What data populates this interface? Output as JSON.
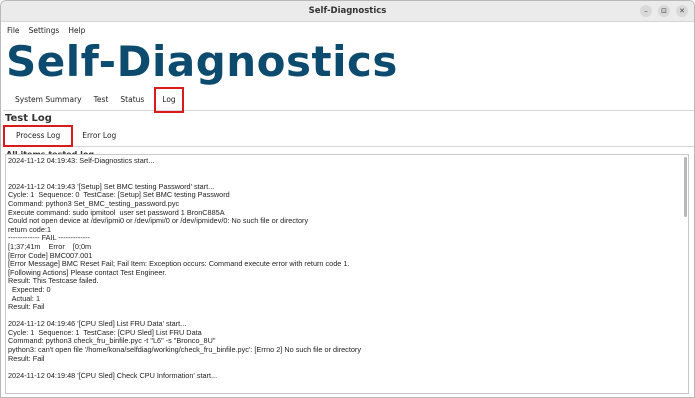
{
  "window": {
    "title": "Self-Diagnostics",
    "controls": [
      "–",
      "⊡",
      "✕"
    ]
  },
  "menu": [
    "File",
    "Settings",
    "Help"
  ],
  "app_title": "Self-Diagnostics",
  "tabs": [
    "System Summary",
    "Test",
    "Status",
    "Log"
  ],
  "section_title": "Test Log",
  "subtabs": [
    "Process Log",
    "Error Log"
  ],
  "log_header": "All items tested log",
  "log_lines": [
    "2024-11-12 04:19:43: Self-Diagnostics start...",
    "",
    "",
    "2024-11-12 04:19:43 '[Setup] Set BMC testing Password' start...",
    "Cycle: 1  Sequence: 0  TestCase: [Setup] Set BMC testing Password",
    "Command: python3 Set_BMC_testing_password.pyc",
    "Execute command: sudo ipmitool  user set password 1 BronC885A",
    "Could not open device at /dev/ipmi0 or /dev/ipmi/0 or /dev/ipmidev/0: No such file or directory",
    "return code:1",
    "------------- FAIL -------------",
    "[1;37;41m    Error    [0;0m",
    "[Error Code] BMC007.001",
    "[Error Message] BMC Reset Fail; Fail Item: Exception occurs: Command execute error with return code 1.",
    "[Following Actions] Please contact Test Engineer.",
    "Result: This Testcase failed.",
    "  Expected: 0",
    "  Actual: 1",
    "Result: Fail",
    "",
    "2024-11-12 04:19:46 '[CPU Sled] List FRU Data' start...",
    "Cycle: 1  Sequence: 1  TestCase: [CPU Sled] List FRU Data",
    "Command: python3 check_fru_binfile.pyc -t \"L6\" -s \"Bronco_8U\"",
    "python3: can't open file '/home/kona/selfdiag/working/check_fru_binfile.pyc': [Errno 2] No such file or directory",
    "Result: Fail",
    "",
    "2024-11-12 04:19:48 '[CPU Sled] Check CPU Information' start..."
  ]
}
